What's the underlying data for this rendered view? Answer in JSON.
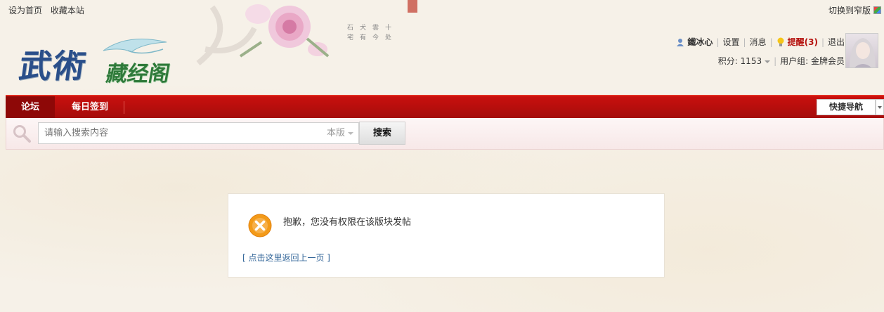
{
  "top_links": {
    "set_home": "设为首页",
    "bookmark": "收藏本站"
  },
  "switch_width": "切换到窄版",
  "site_logo": {
    "main": "武術",
    "sub": "藏经阁"
  },
  "user": {
    "name": "鐵冰心",
    "settings": "设置",
    "messages": "消息",
    "reminders": "提醒(3)",
    "logout": "退出",
    "points_label": "积分: 1153",
    "group_label": "用户组: 金牌会员"
  },
  "nav": {
    "items": [
      {
        "label": "论坛"
      },
      {
        "label": "每日签到"
      }
    ],
    "quick_nav": "快捷导航"
  },
  "search": {
    "placeholder": "请输入搜索内容",
    "scope": "本版",
    "button": "搜索"
  },
  "message": {
    "text": "抱歉，您没有权限在该版块发帖",
    "back_link": "[ 点击这里返回上一页 ]"
  },
  "colors": {
    "nav_red": "#c9100e",
    "nav_active": "#8e0807",
    "remind_red": "#b5120e",
    "error_orange": "#f39a18",
    "link_blue": "#336699"
  },
  "icons": {
    "user": "user-icon",
    "bulb": "bulb-icon",
    "search": "search-magnifier-icon",
    "error": "error-x-icon"
  }
}
